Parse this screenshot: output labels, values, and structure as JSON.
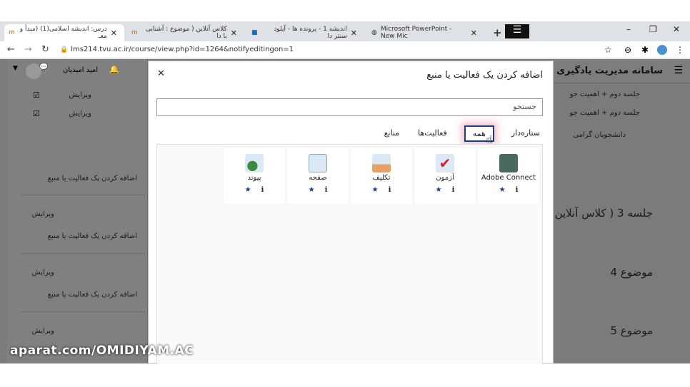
{
  "browser": {
    "tabs": [
      {
        "label": "درس: اندیشه اسلامی(1) (مبدأ و معـ",
        "active": true
      },
      {
        "label": "کلاس آنلاین ( موضوع : آشنایی با دا"
      },
      {
        "label": "اندیشه 1 - پرونده ها - آپلود سنتر دا"
      },
      {
        "label": "Microsoft PowerPoint - New Mic"
      }
    ],
    "new_tab": "+",
    "url": "lms214.tvu.ac.ir/course/view.php?id=1264&notifyeditingon=1"
  },
  "header": {
    "site_title": "سامانه مدیریت یادگیری ا",
    "user": "امید امیدیان"
  },
  "drawer": {
    "edit": "ویرایش",
    "add": "اضافه کردن یک فعالیت یا منبع"
  },
  "course": {
    "items": [
      "جلسه دوم + اهمیت جو",
      "جلسه دوم + اهمیت جو"
    ],
    "notice": "دانشجویان گرامی",
    "sections": [
      "جلسه 3 ( کلاس آنلاین",
      "موضوع 4",
      "موضوع 5"
    ]
  },
  "modal": {
    "title": "اضافه کردن یک فعالیت یا منبع",
    "search_placeholder": "جستجو",
    "tabs": [
      "ستاره‌دار",
      "همه",
      "فعالیت‌ها",
      "منابع"
    ],
    "selected_tab": "همه",
    "items": [
      {
        "name": "Adobe Connect",
        "icon": "adobe-connect-icon"
      },
      {
        "name": "آزمون",
        "icon": "quiz-icon"
      },
      {
        "name": "تکلیف",
        "icon": "assignment-icon"
      },
      {
        "name": "صفحه",
        "icon": "page-icon"
      },
      {
        "name": "پیوند",
        "icon": "url-icon"
      }
    ]
  },
  "watermark": "aparat.com/OMIDIYAM.AC"
}
